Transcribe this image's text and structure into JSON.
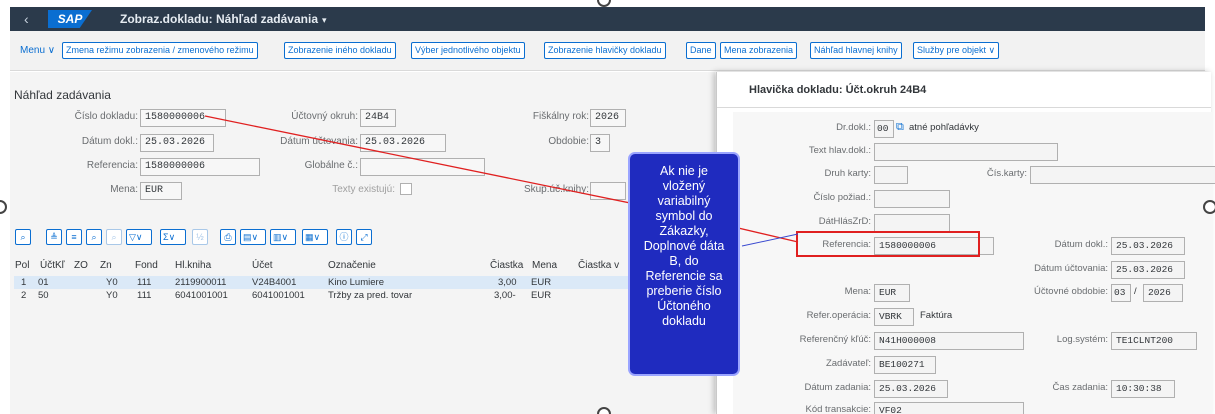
{
  "shell": {
    "logo": "SAP",
    "title": "Zobraz.dokladu: Náhľad zadávania",
    "back_glyph": "‹"
  },
  "toolbar": {
    "menu": "Menu ∨",
    "buttons": [
      "Zmena režimu zobrazenia / zmenového režimu",
      "Zobrazenie iného dokladu",
      "Výber jednotlivého objektu",
      "Zobrazenie hlavičky dokladu",
      "Dane",
      "Mena zobrazenia",
      "Náhľad hlavnej knihy",
      "Služby pre objekt ∨"
    ]
  },
  "main": {
    "title": "Náhľad zadávania",
    "fields": {
      "cislo_dokladu_label": "Číslo dokladu:",
      "cislo_dokladu": "1580000006",
      "uctovny_okruh_label": "Účtovný okruh:",
      "uctovny_okruh": "24B4",
      "fiskalny_rok_label": "Fiškálny rok:",
      "fiskalny_rok": "2026",
      "datum_dokl_label": "Dátum dokl.:",
      "datum_dokl": "25.03.2026",
      "datum_uctovania_label": "Dátum účtovania:",
      "datum_uctovania": "25.03.2026",
      "obdobie_label": "Obdobie:",
      "obdobie": "3",
      "referencia_label": "Referencia:",
      "referencia": "1580000006",
      "globalne_c_label": "Globálne č.:",
      "globalne_c": "",
      "mena_label": "Mena:",
      "mena": "EUR",
      "texty_label": "Texty existujú:",
      "skup_label": "Skup.úč.knihy:",
      "skup": ""
    },
    "alv_icons": [
      "search-icon",
      "align-icon",
      "filter-lines-icon",
      "find-icon",
      "find-next-icon",
      "filter-icon",
      "sum-icon",
      "subtotal-icon",
      "print-icon",
      "export-icon",
      "layout-icon",
      "view-icon",
      "info-icon",
      "fullscreen-icon"
    ],
    "columns": [
      "Pol",
      "ÚčtKľ",
      "ZO",
      "Zn",
      "Fond",
      "Hl.kniha",
      "Účet",
      "Označenie",
      "Čiastka",
      "Mena",
      "Čiastka v"
    ],
    "rows": [
      [
        "1",
        "01",
        "",
        "Y0",
        "111",
        "2119900011",
        "V24B4001",
        "Kino Lumiere",
        "3,00",
        "EUR"
      ],
      [
        "2",
        "50",
        "",
        "Y0",
        "111",
        "6041001001",
        "6041001001",
        "Tržby za pred. tovar",
        "3,00-",
        "EUR"
      ]
    ]
  },
  "dialog": {
    "title": "Hlavička dokladu: Účt.okruh 24B4",
    "dr_dokl_label": "Dr.dokl.:",
    "dr_dokl": "00",
    "dr_dokl_text": "atné pohľadávky",
    "text_hlav_label": "Text hlav.dokl.:",
    "text_hlav": "",
    "druh_karty_label": "Druh karty:",
    "druh_karty": "",
    "cis_karty_label": "Čís.karty:",
    "cis_karty": "",
    "cislo_poziad_label": "Číslo požiad.:",
    "cislo_poziad": "",
    "dat_label": "DátHlásZrD:",
    "dat": "",
    "referencia_label": "Referencia:",
    "referencia": "1580000006",
    "datum_dokl_label": "Dátum dokl.:",
    "datum_dokl": "25.03.2026",
    "datum_uctovania_label": "Dátum účtovania:",
    "datum_uctovania": "25.03.2026",
    "mena_label": "Mena:",
    "mena": "EUR",
    "uctovne_obdobie_label": "Účtovné obdobie:",
    "obdobie_mesiac": "03",
    "obdobie_sep": "/",
    "obdobie_rok": "2026",
    "refer_operacia_label": "Refer.operácia:",
    "refer_operacia": "VBRK",
    "refer_operacia_text": "Faktúra",
    "ref_kluc_label": "Referenčný kľúč:",
    "ref_kluc": "N41H000008",
    "log_system_label": "Log.systém:",
    "log_system": "TE1CLNT200",
    "zadavatel_label": "Zadávateľ:",
    "zadavatel": "BE100271",
    "datum_zadania_label": "Dátum zadania:",
    "datum_zadania": "25.03.2026",
    "cas_zadania_label": "Čas zadania:",
    "cas_zadania": "10:30:38",
    "kod_transakcie_label": "Kód transakcie:",
    "kod_transakcie": "VF02"
  },
  "callout": {
    "lines": [
      "Ak nie je",
      "vložený",
      "variabilný",
      "symbol do",
      "Zákazky,",
      "Doplnové dáta",
      "B, do",
      "Referencie sa",
      "preberie číslo",
      "Účtoného",
      "dokladu"
    ],
    "bg_color": "#1f2bbf",
    "arrow_color": "#e02020"
  }
}
